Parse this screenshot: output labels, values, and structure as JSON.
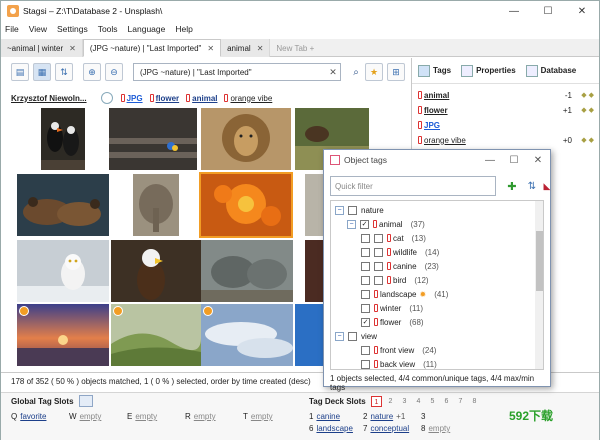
{
  "window": {
    "title": "Stagsi – Z:\\T\\Database 2 - Unsplash\\",
    "controls": [
      "—",
      "☐",
      "✕"
    ]
  },
  "menu": [
    "File",
    "View",
    "Settings",
    "Tools",
    "Language",
    "Help"
  ],
  "tabs": [
    {
      "label": "~animal | winter",
      "close": "✕"
    },
    {
      "label": "(JPG ~nature) | \"Last Imported\"",
      "close": "✕"
    },
    {
      "label": "animal",
      "close": "✕"
    },
    {
      "label": "New Tab +"
    }
  ],
  "search": {
    "value": "(JPG ~nature) | \"Last Imported\"",
    "clear": "✕"
  },
  "pathbar": {
    "author": "Krzysztof Niewoln...",
    "tags": [
      "JPG",
      "flower",
      "animal",
      "orange vibe"
    ]
  },
  "status": "178 of 352 ( 50 % ) objects matched, 1 ( 0 % ) selected, order by time created (desc)",
  "right_panel": {
    "tabs": [
      "Tags",
      "Properties",
      "Database"
    ],
    "rows": [
      {
        "label": "animal",
        "value": "-1",
        "dots": "◆ ◆"
      },
      {
        "label": "flower",
        "value": "+1",
        "dots": "◆ ◆"
      },
      {
        "label": "JPG",
        "value": "",
        "dots": ""
      },
      {
        "label": "orange vibe",
        "value": "+0",
        "dots": "◆ ◆"
      }
    ]
  },
  "dialog": {
    "title": "Object tags",
    "filter_placeholder": "Quick filter",
    "tree": [
      {
        "label": "nature",
        "count": "",
        "level": 0,
        "exp": "−",
        "cb": ""
      },
      {
        "label": "animal",
        "count": "(37)",
        "level": 1,
        "exp": "−",
        "cb": "✓"
      },
      {
        "label": "cat",
        "count": "(13)",
        "level": 2,
        "exp": "+",
        "cb": ""
      },
      {
        "label": "wildlife",
        "count": "(14)",
        "level": 2,
        "exp": "+",
        "cb": ""
      },
      {
        "label": "canine",
        "count": "(23)",
        "level": 2,
        "exp": "+",
        "cb": ""
      },
      {
        "label": "bird",
        "count": "(12)",
        "level": 2,
        "exp": "+",
        "cb": ""
      },
      {
        "label": "landscape",
        "count": "(41)",
        "level": 1,
        "exp": "",
        "cb": ""
      },
      {
        "label": "winter",
        "count": "(11)",
        "level": 1,
        "exp": "",
        "cb": ""
      },
      {
        "label": "flower",
        "count": "(68)",
        "level": 1,
        "exp": "",
        "cb": "✓"
      },
      {
        "label": "view",
        "count": "",
        "level": 0,
        "exp": "−",
        "cb": ""
      },
      {
        "label": "front view",
        "count": "(24)",
        "level": 1,
        "exp": "",
        "cb": ""
      },
      {
        "label": "back view",
        "count": "(11)",
        "level": 1,
        "exp": "",
        "cb": ""
      }
    ],
    "status": "1 objects selected, 4/4 common/unique tags, 4/4 max/min tags"
  },
  "global_slots": {
    "heading": "Global Tag Slots",
    "items": [
      {
        "key": "Q",
        "value": "favorite"
      },
      {
        "key": "W",
        "value": "empty"
      },
      {
        "key": "E",
        "value": "empty"
      },
      {
        "key": "R",
        "value": "empty"
      },
      {
        "key": "T",
        "value": "empty"
      }
    ]
  },
  "deck_slots": {
    "heading": "Tag Deck Slots",
    "pages": [
      "1",
      "2",
      "3",
      "4",
      "5",
      "6",
      "7",
      "8"
    ],
    "items": [
      {
        "key": "1",
        "value": "canine",
        "count": ""
      },
      {
        "key": "2",
        "value": "nature",
        "count": "+1"
      },
      {
        "key": "3",
        "value": "",
        "count": ""
      },
      {
        "key": "6",
        "value": "landscape",
        "count": ""
      },
      {
        "key": "7",
        "value": "conceptual",
        "count": ""
      },
      {
        "key": "8",
        "value": "empty",
        "count": ""
      }
    ]
  },
  "watermark": "592下载",
  "colors": {
    "accent": "#f29d24",
    "link": "#1c3f8a",
    "tag_red": "#d33333"
  }
}
